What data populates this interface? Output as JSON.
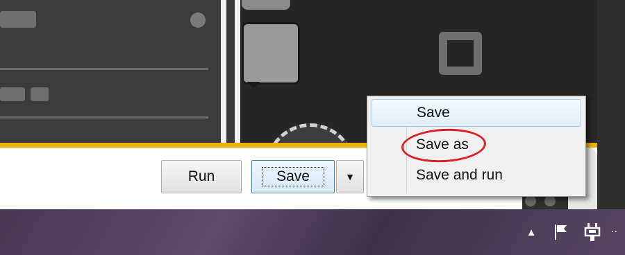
{
  "notification_bar": {
    "run_label": "Run",
    "save_label": "Save",
    "dropdown_arrow": "▼"
  },
  "save_menu": {
    "items": [
      {
        "label": "Save",
        "state": "hover"
      },
      {
        "label": "Save as",
        "state": "highlighted-by-annotation"
      },
      {
        "label": "Save and run",
        "state": "normal"
      }
    ]
  },
  "taskbar": {
    "tray_icons": [
      "show-hidden-icons-arrow-icon",
      "action-center-flag-icon",
      "power-plug-icon",
      "overflow-dots-icon"
    ],
    "show_hidden_glyph": "▲",
    "overflow_glyph": ".."
  },
  "colors": {
    "notification_border": "#e8b10a",
    "annotation_ring": "#d8202a",
    "menu_hover_border": "#a8cae9",
    "save_button_border": "#3c7fb1"
  }
}
